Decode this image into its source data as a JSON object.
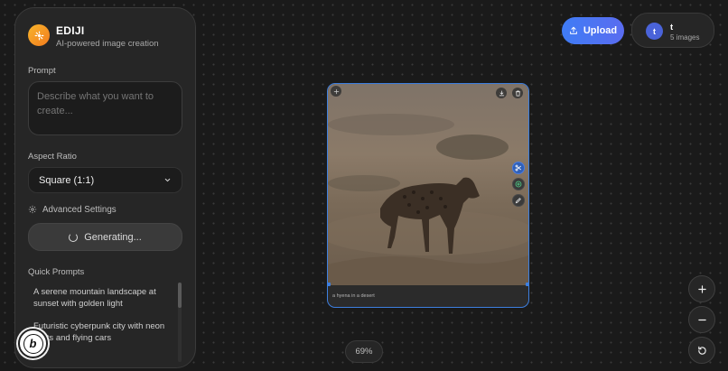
{
  "app": {
    "title": "EDIJI",
    "subtitle": "AI-powered image creation"
  },
  "prompt": {
    "label": "Prompt",
    "placeholder": "Describe what you want to create..."
  },
  "aspect_ratio": {
    "label": "Aspect Ratio",
    "selected": "Square (1:1)"
  },
  "advanced_settings_label": "Advanced Settings",
  "generate_button_label": "Generating...",
  "quick_prompts": {
    "label": "Quick Prompts",
    "items": [
      "A serene mountain landscape at sunset with golden light",
      "Futuristic cyberpunk city with neon lights and flying cars"
    ]
  },
  "header": {
    "upload_label": "Upload",
    "user": {
      "initial": "t",
      "name": "t",
      "image_count": "5 images"
    }
  },
  "canvas": {
    "image_caption": "a hyena in a desert",
    "zoom": "69%"
  },
  "colors": {
    "accent": "#3d7fe0",
    "upload_gradient_start": "#3f7cf5",
    "logo": "#f59e1d"
  }
}
